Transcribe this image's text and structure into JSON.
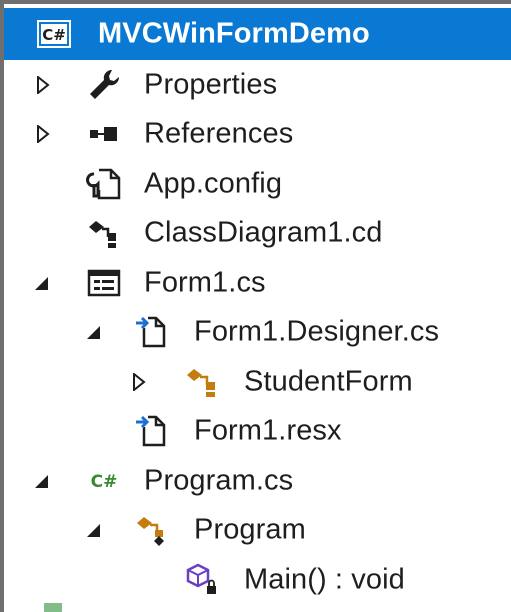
{
  "project": {
    "name": "MVCWinFormDemo",
    "icon": "csharp-project-icon"
  },
  "tree": [
    {
      "label": "Properties",
      "expander": "collapsed",
      "icon": "wrench-icon"
    },
    {
      "label": "References",
      "expander": "collapsed",
      "icon": "references-icon"
    },
    {
      "label": "App.config",
      "expander": "none",
      "icon": "config-file-icon"
    },
    {
      "label": "ClassDiagram1.cd",
      "expander": "none",
      "icon": "class-diagram-icon"
    },
    {
      "label": "Form1.cs",
      "expander": "expanded",
      "icon": "windows-form-icon"
    },
    {
      "label": "Form1.Designer.cs",
      "expander": "expanded",
      "icon": "dependent-file-icon"
    },
    {
      "label": "StudentForm",
      "expander": "collapsed",
      "icon": "class-icon"
    },
    {
      "label": "Form1.resx",
      "expander": "none",
      "icon": "dependent-file-icon"
    },
    {
      "label": "Program.cs",
      "expander": "expanded",
      "icon": "csharp-file-icon"
    },
    {
      "label": "Program",
      "expander": "expanded",
      "icon": "static-class-icon"
    },
    {
      "label": "Main() : void",
      "expander": "none",
      "icon": "private-method-icon"
    }
  ],
  "colors": {
    "selection": "#0a79d3",
    "class_orange": "#c27d0e",
    "csharp_green": "#388a34",
    "method_purple": "#6c3fc2"
  }
}
